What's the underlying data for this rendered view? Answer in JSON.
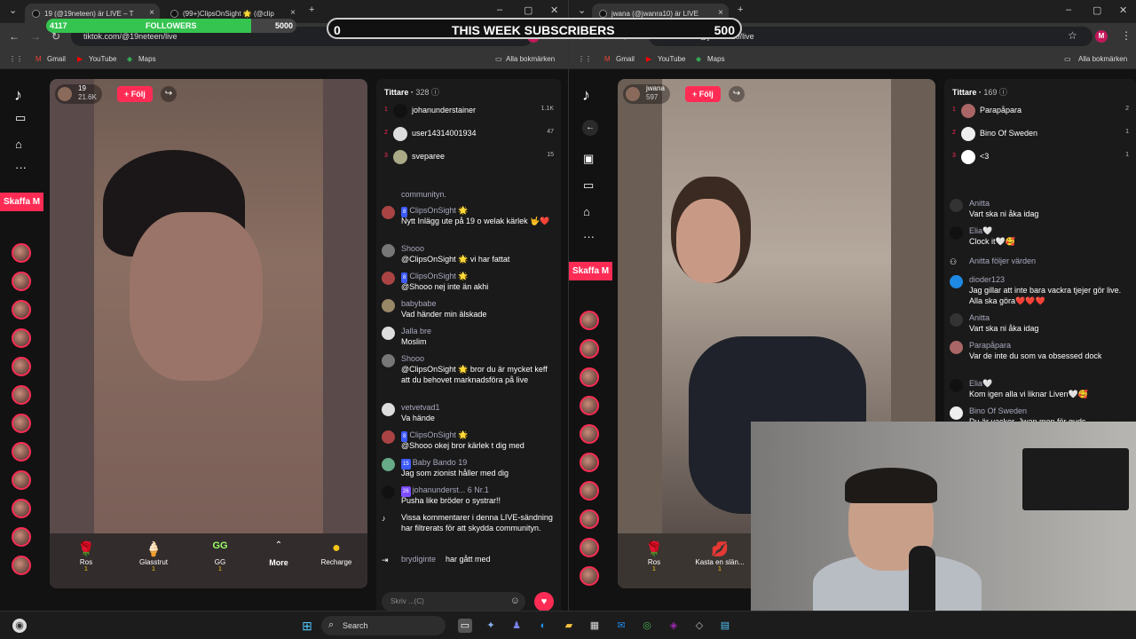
{
  "left_browser": {
    "tabs": [
      {
        "title": "19 (@19neteen) är LIVE – T",
        "active": true
      },
      {
        "title": "(99+)ClipsOnSight 🌟 (@clip",
        "active": false
      }
    ],
    "url": "tiktok.com/@19neteen/live",
    "bookmarks": [
      "Gmail",
      "YouTube",
      "Maps"
    ],
    "all_bookmarks": "Alla bokmärken",
    "sidebar_button": "Skaffa M",
    "host": {
      "name": "19",
      "likes": "21.6K"
    },
    "follow_label": "+ Följ",
    "gifts": [
      {
        "name": "Ros",
        "coins": "1",
        "icon": "🌹"
      },
      {
        "name": "Glasstrut",
        "coins": "1",
        "icon": "🍦"
      },
      {
        "name": "GG",
        "coins": "1",
        "icon": "GG"
      },
      {
        "name": "More",
        "coins": "",
        "icon": "⌃"
      },
      {
        "name": "Recharge",
        "coins": "",
        "icon": "●"
      }
    ],
    "viewers": {
      "title": "Tittare",
      "count": "328",
      "list": [
        {
          "rank": "1",
          "name": "johanunderstainer",
          "count": "1.1K"
        },
        {
          "rank": "2",
          "name": "user14314001934",
          "count": "47"
        },
        {
          "rank": "3",
          "name": "sveparee",
          "count": "15"
        }
      ]
    },
    "messages": [
      {
        "user": "",
        "text": "communityn."
      },
      {
        "user": "ClipsOnSight 🌟",
        "badge": "8",
        "text": "Nytt Inlägg ute på 19 o welak kärlek 🤟❤️"
      },
      {
        "user": "Shooo",
        "badge": "",
        "text": "@ClipsOnSight 🌟 vi har fattat"
      },
      {
        "user": "ClipsOnSight 🌟",
        "badge": "8",
        "text": "@Shooo nej inte än akhi"
      },
      {
        "user": "babybabe",
        "badge": "",
        "text": "Vad händer min älskade"
      },
      {
        "user": "Jalla bre",
        "badge": "",
        "text": "Moslim"
      },
      {
        "user": "Shooo",
        "badge": "",
        "text": "@ClipsOnSight 🌟 bror du är mycket keff att du behovet marknadsföra på live"
      },
      {
        "user": "vetvetvad1",
        "badge": "",
        "text": "Va hände"
      },
      {
        "user": "ClipsOnSight 🌟",
        "badge": "8",
        "text": "@Shooo okej bror kärlek t dig med"
      },
      {
        "user": "Baby Bando 19",
        "badge": "15",
        "text": "Jag som zionist håller med dig"
      },
      {
        "user": "johanunderst... 6 Nr.1",
        "badge": "26",
        "text": "Pusha like bröder o systrar!!"
      },
      {
        "user": "",
        "badge": "",
        "text": "Vissa kommentarer i denna LIVE-sändning har filtrerats för att skydda communityn."
      },
      {
        "user": "brydiginte",
        "badge": "",
        "text": "har gått med"
      }
    ],
    "input_placeholder": "Skriv ...(C)"
  },
  "right_browser": {
    "tab": "jwana (@jwanra10) är LIVE",
    "url": "tiktok.com/@jwanra10/live",
    "bookmarks": [
      "Gmail",
      "YouTube",
      "Maps"
    ],
    "all_bookmarks": "Alla bokmärken",
    "sidebar_button": "Skaffa M",
    "host": {
      "name": "jwana",
      "likes": "597"
    },
    "follow_label": "+ Följ",
    "gifts": [
      {
        "name": "Ros",
        "coins": "1",
        "icon": "🌹"
      },
      {
        "name": "Kasta en slän...",
        "coins": "1",
        "icon": "💋"
      }
    ],
    "viewers": {
      "title": "Tittare",
      "count": "169",
      "list": [
        {
          "rank": "1",
          "name": "Parapåpara",
          "count": "2"
        },
        {
          "rank": "2",
          "name": "Bino Of Sweden",
          "count": "1"
        },
        {
          "rank": "3",
          "name": "<3",
          "count": "1"
        }
      ]
    },
    "messages": [
      {
        "user": "Anitta",
        "text": "Vart ska ni åka idag"
      },
      {
        "user": "Elia🤍",
        "text": "Clock it🤍🥰"
      },
      {
        "user": "Anitta följer värden",
        "text": ""
      },
      {
        "user": "dioder123",
        "text": "Jag gillar att inte bara vackra tjejer gör live. Alla ska göra❤️❤️❤️"
      },
      {
        "user": "Anitta",
        "text": "Vart ska ni åka idag"
      },
      {
        "user": "Parapåpara",
        "text": "Var de inte du som va obsessed dock"
      },
      {
        "user": "Elia🤍",
        "text": "Kom igen alla vi liknar Liven🤍🥰"
      },
      {
        "user": "Bino Of Sweden",
        "text": "Du är vacker, Jwan men för guds"
      }
    ]
  },
  "overlay": {
    "followers_current": "4117",
    "followers_label": "FOLLOWERS",
    "followers_goal": "5000",
    "followers_progress": 0.82,
    "subs_current": "0",
    "subs_label": "THIS WEEK SUBSCRIBERS",
    "subs_goal": "500"
  },
  "taskbar": {
    "search": "Search"
  },
  "colors": {
    "accent": "#fe2c55",
    "progress": "#35c450"
  }
}
